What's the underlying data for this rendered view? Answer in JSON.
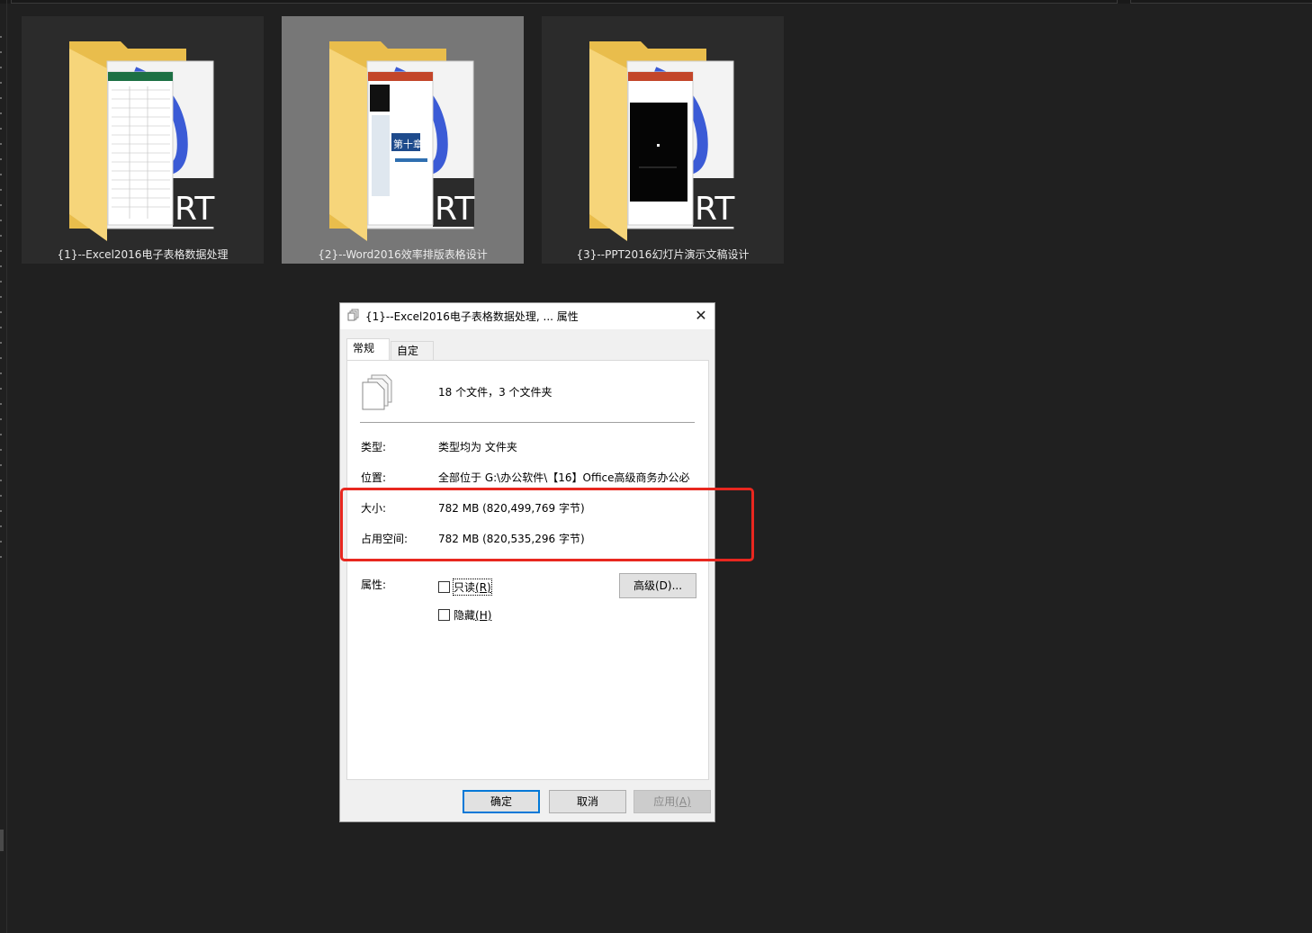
{
  "folders": [
    {
      "name": "{1}--Excel2016电子表格数据处理",
      "preview": "excel-sheet",
      "selected": false
    },
    {
      "name": "{2}--Word2016效率排版表格设计",
      "preview": "word-doc",
      "selected": true
    },
    {
      "name": "{3}--PPT2016幻灯片演示文稿设计",
      "preview": "ppt-slide",
      "selected": false
    }
  ],
  "folder_art": {
    "cover_text": "RT",
    "word_title_text": "第十章"
  },
  "dialog": {
    "title": "{1}--Excel2016电子表格数据处理, ... 属性",
    "close_glyph": "✕",
    "tabs": [
      {
        "label": "常规",
        "active": true
      },
      {
        "label": "自定义",
        "active": false
      }
    ],
    "summary": "18 个文件，3 个文件夹",
    "rows": {
      "type": {
        "label": "类型:",
        "value": "类型均为 文件夹"
      },
      "location": {
        "label": "位置:",
        "value": "全部位于 G:\\办公软件\\【16】Office高级商务办公必"
      },
      "size": {
        "label": "大小:",
        "value": "782 MB (820,499,769 字节)"
      },
      "size_on_disk": {
        "label": "占用空间:",
        "value": "782 MB (820,535,296 字节)"
      }
    },
    "attributes": {
      "label": "属性:",
      "readonly": {
        "label": "只读",
        "hotkey": "(R)",
        "checked": false
      },
      "hidden": {
        "label": "隐藏",
        "hotkey": "(H)",
        "checked": false
      },
      "advanced_button": {
        "label": "高级",
        "hotkey": "(D)...",
        "full": "高级(D)..."
      }
    },
    "buttons": {
      "ok": "确定",
      "cancel": "取消",
      "apply": "应用",
      "apply_hotkey": "(A)"
    }
  },
  "colors": {
    "highlight": "#e8271f",
    "folder": "#f6d57a",
    "selected_tile": "#777777",
    "accent": "#0078d7"
  }
}
